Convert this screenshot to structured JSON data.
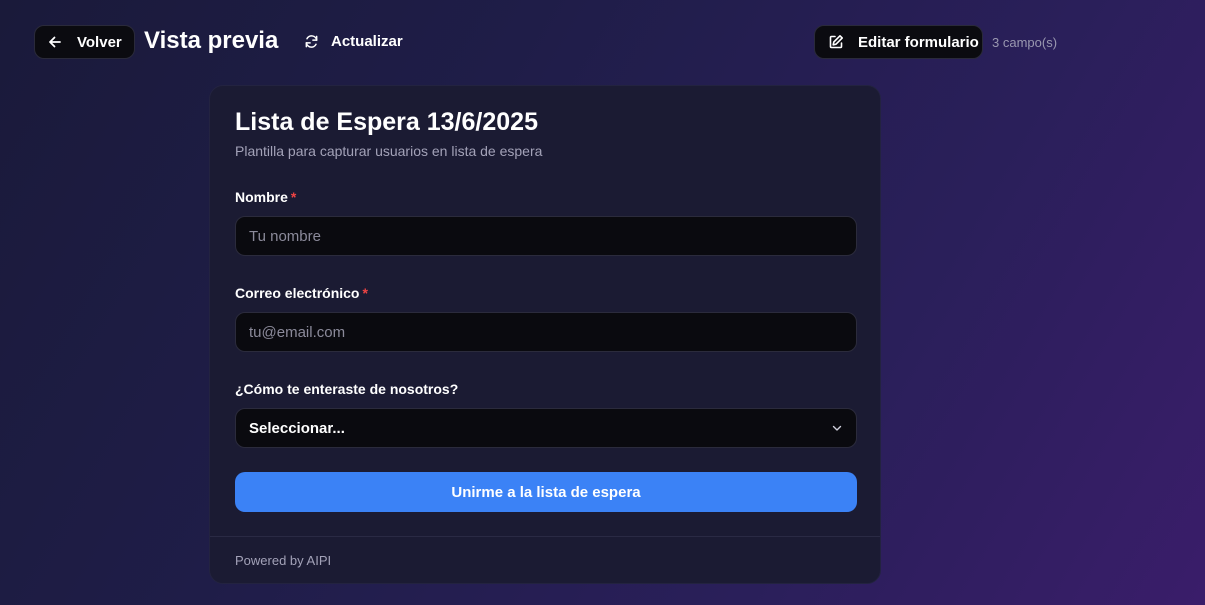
{
  "header": {
    "back_label": "Volver",
    "title": "Vista previa",
    "refresh_label": "Actualizar",
    "edit_label": "Editar formulario",
    "field_count": "3 campo(s)"
  },
  "form": {
    "title": "Lista de Espera 13/6/2025",
    "subtitle": "Plantilla para capturar usuarios en lista de espera",
    "fields": [
      {
        "label": "Nombre",
        "required_mark": "*",
        "placeholder": "Tu nombre"
      },
      {
        "label": "Correo electrónico",
        "required_mark": "*",
        "placeholder": "tu@email.com"
      },
      {
        "label": "¿Cómo te enteraste de nosotros?",
        "selected": "Seleccionar..."
      }
    ],
    "submit_label": "Unirme a la lista de espera",
    "footer": "Powered by AIPI"
  },
  "colors": {
    "accent": "#3b82f6",
    "required": "#ef4444"
  },
  "icons": [
    "arrow-left-icon",
    "refresh-icon",
    "edit-icon",
    "chevron-down-icon"
  ]
}
